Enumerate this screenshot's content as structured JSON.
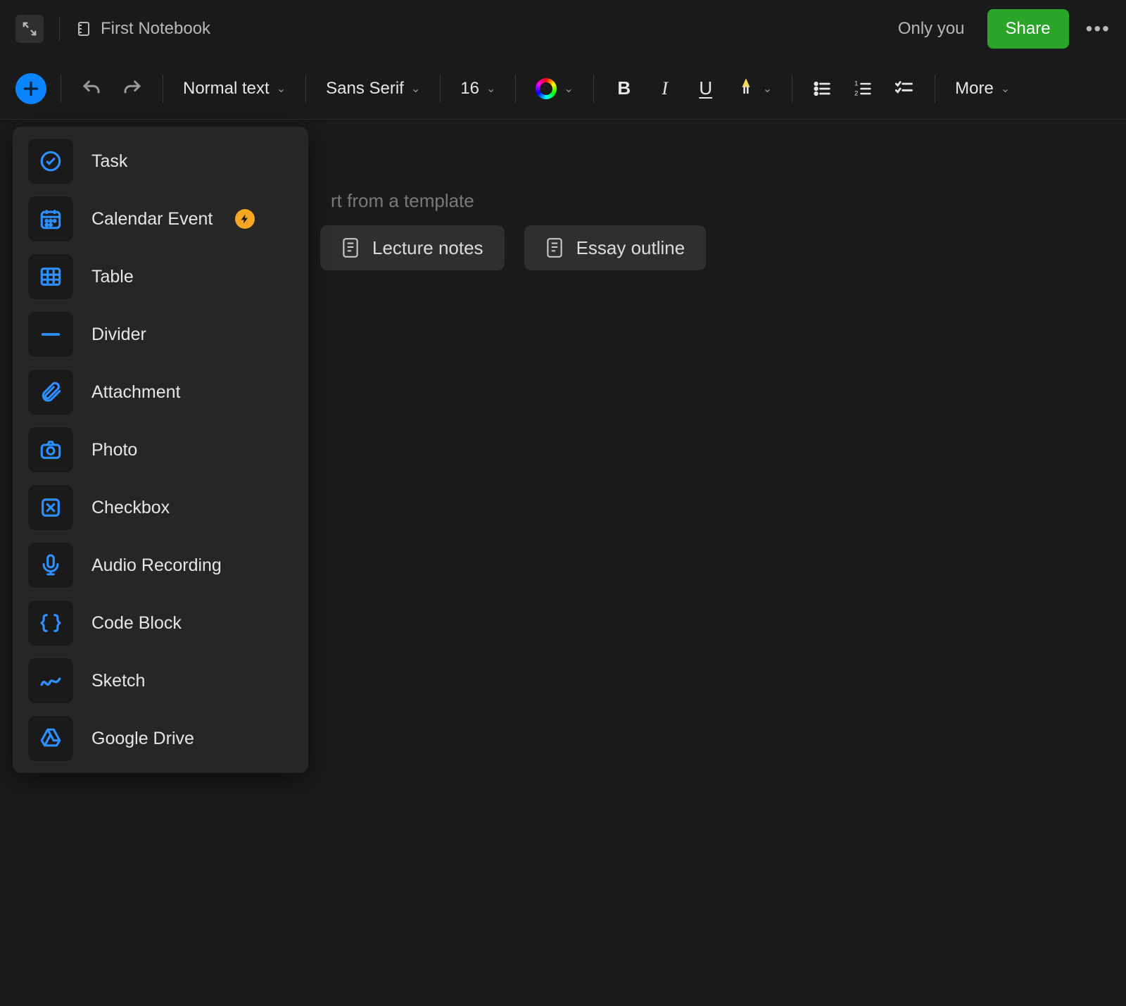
{
  "header": {
    "notebook_name": "First Notebook",
    "visibility": "Only you",
    "share_label": "Share"
  },
  "toolbar": {
    "text_style": "Normal text",
    "font_family": "Sans Serif",
    "font_size": "16",
    "more_label": "More"
  },
  "content": {
    "template_hint_partial": "rt from a template",
    "template_chips": [
      {
        "label": "Lecture notes"
      },
      {
        "label": "Essay outline"
      }
    ]
  },
  "insert_menu": {
    "items": [
      {
        "label": "Task",
        "icon": "task-check-icon",
        "badge": false
      },
      {
        "label": "Calendar Event",
        "icon": "calendar-icon",
        "badge": true
      },
      {
        "label": "Table",
        "icon": "table-icon",
        "badge": false
      },
      {
        "label": "Divider",
        "icon": "divider-icon",
        "badge": false
      },
      {
        "label": "Attachment",
        "icon": "attachment-icon",
        "badge": false
      },
      {
        "label": "Photo",
        "icon": "camera-icon",
        "badge": false
      },
      {
        "label": "Checkbox",
        "icon": "checkbox-icon",
        "badge": false
      },
      {
        "label": "Audio Recording",
        "icon": "microphone-icon",
        "badge": false
      },
      {
        "label": "Code Block",
        "icon": "code-braces-icon",
        "badge": false
      },
      {
        "label": "Sketch",
        "icon": "sketch-icon",
        "badge": false
      },
      {
        "label": "Google Drive",
        "icon": "google-drive-icon",
        "badge": false
      }
    ]
  },
  "colors": {
    "accent_blue": "#0a84ff",
    "share_green": "#2aa52a",
    "menu_icon_blue": "#2e8fff",
    "badge_orange": "#f5a623"
  }
}
